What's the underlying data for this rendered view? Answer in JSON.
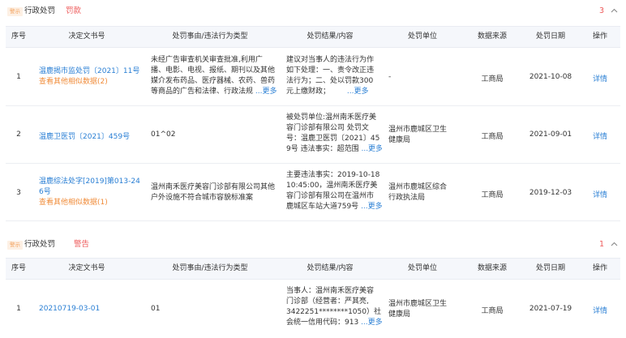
{
  "sections": [
    {
      "badge": "警示",
      "title": "行政处罚",
      "tag": "罚款",
      "count": "3",
      "columns": [
        "序号",
        "决定文书号",
        "处罚事由/违法行为类型",
        "处罚结果/内容",
        "处罚单位",
        "数据来源",
        "处罚日期",
        "操作"
      ],
      "rows": [
        {
          "no": "1",
          "doc": "温鹿揭市监处罚〔2021〕11号",
          "doc_extra": "查看其他相似数据(2)",
          "reason": [
            "未经广告审查机关审查批准,利用广",
            "播、电影、电视、报纸、期刊以及其他",
            "媒介发布药品、医疗器械、农药、兽药",
            "等商品的广告和法律、行政法规"
          ],
          "result": [
            "建议对当事人的违法行为作",
            "如下处理：一、责令改正违",
            "法行为；二、处以罚款300",
            "元上缴财政；"
          ],
          "unit": "-",
          "source": "工商局",
          "date": "2021-10-08",
          "action": "详情"
        },
        {
          "no": "2",
          "doc": "温鹿卫医罚〔2021〕459号",
          "reason": [
            "01^02"
          ],
          "result": [
            "被处罚单位:温州南禾医疗美",
            "容门诊部有限公司 处罚文",
            "号：温鹿卫医罚〔2021〕45",
            "9号 违法事实：超范围"
          ],
          "unit": [
            "温州市鹿城区卫生",
            "健康局"
          ],
          "source": "工商局",
          "date": "2021-09-01",
          "action": "详情"
        },
        {
          "no": "3",
          "doc": "温鹿综法处字[2019]第013-24",
          "doc2": "6号",
          "doc_extra": "查看其他相似数据(1)",
          "reason": [
            "温州南禾医疗美容门诊部有限公司其他",
            "户外设施不符合城市容貌标准案"
          ],
          "result": [
            "主要违法事实：2019-10-18",
            "10:45:00，温州南禾医疗美",
            "容门诊部有限公司在温州市",
            "鹿城区车站大道759号"
          ],
          "unit": [
            "温州市鹿城区综合",
            "行政执法局"
          ],
          "source": "工商局",
          "date": "2019-12-03",
          "action": "详情"
        }
      ]
    },
    {
      "badge": "警示",
      "title": "行政处罚",
      "tag": "警告",
      "count": "1",
      "columns": [
        "序号",
        "决定文书号",
        "处罚事由/违法行为类型",
        "处罚结果/内容",
        "处罚单位",
        "数据来源",
        "处罚日期",
        "操作"
      ],
      "rows": [
        {
          "no": "1",
          "doc": "20210719-03-01",
          "reason": [
            "01"
          ],
          "result": [
            "当事人：温州南禾医疗美容",
            "门诊部（经营者：严其亮,",
            "3422251********1050）社",
            "会统一信用代码：913"
          ],
          "unit": [
            "温州市鹿城区卫生",
            "健康局"
          ],
          "source": "工商局",
          "date": "2021-07-19",
          "action": "详情"
        }
      ]
    }
  ],
  "more_label": "...更多",
  "colors": {
    "link": "#2a7fd4",
    "warn": "#ee5b5b",
    "badge_bg": "#fdf0e4",
    "badge_fg": "#f3a05b",
    "header_bg": "#f5f7fb"
  }
}
